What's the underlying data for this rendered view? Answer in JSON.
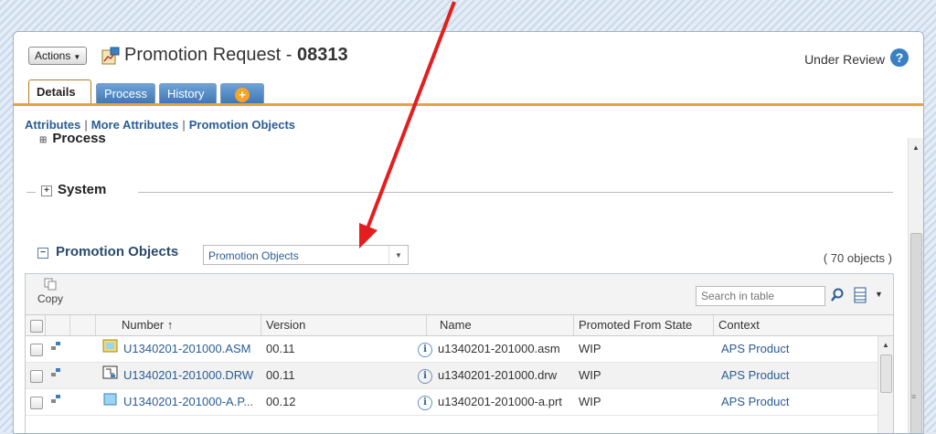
{
  "header": {
    "actions_label": "Actions",
    "title_prefix": "Promotion Request - ",
    "title_number": "08313",
    "status": "Under Review",
    "help_icon": "?"
  },
  "tabs": [
    {
      "label": "Details",
      "active": true
    },
    {
      "label": "Process",
      "active": false
    },
    {
      "label": "History",
      "active": false
    },
    {
      "label": "+",
      "active": false
    }
  ],
  "subnav": {
    "attributes": "Attributes",
    "more_attributes": "More Attributes",
    "promotion_objects": "Promotion Objects",
    "separator": "|"
  },
  "sections": {
    "process": "Process",
    "system": "System",
    "promotion_objects": "Promotion Objects",
    "toggle_collapsed": "⊞",
    "toggle_expanded": "⊟"
  },
  "promotion_objects": {
    "view_select": "Promotion Objects",
    "count": "( 70 objects )",
    "copy_label": "Copy",
    "search_placeholder": "Search in table",
    "columns": [
      "Number ↑",
      "Version",
      "Name",
      "Promoted From State",
      "Context"
    ],
    "rows": [
      {
        "number": "U1340201-201000.ASM",
        "version": "00.11",
        "name": "u1340201-201000.asm",
        "state": "WIP",
        "context": "APS Product",
        "icon": "assembly-icon"
      },
      {
        "number": "U1340201-201000.DRW",
        "version": "00.11",
        "name": "u1340201-201000.drw",
        "state": "WIP",
        "context": "APS Product",
        "icon": "drawing-icon"
      },
      {
        "number": "U1340201-201000-A.P...",
        "version": "00.12",
        "name": "u1340201-201000-a.prt",
        "state": "WIP",
        "context": "APS Product",
        "icon": "part-icon"
      }
    ]
  },
  "colors": {
    "tab_blue": "#3d78b6",
    "accent_orange": "#e6a33a",
    "link_blue": "#2a5d94",
    "annotation_red": "#e41e1e"
  }
}
